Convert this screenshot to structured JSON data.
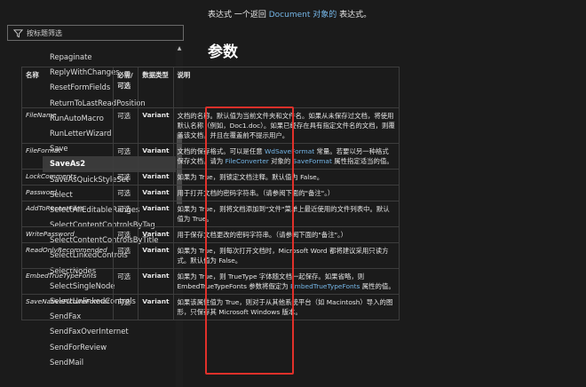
{
  "sidebar": {
    "filter_label": "按标题筛选",
    "items": [
      "Repaginate",
      "ReplyWithChanges",
      "ResetFormFields",
      "ReturnToLastReadPosition",
      "RunAutoMacro",
      "RunLetterWizard",
      "Save",
      "SaveAs2",
      "SaveAsQuickStyleSet",
      "Select",
      "SelectAllEditableRanges",
      "SelectContentControlsByTag",
      "SelectContentControlsByTitle",
      "SelectLinkedControls",
      "SelectNodes",
      "SelectSingleNode",
      "SelectUnlinkedControls",
      "SendFax",
      "SendFaxOverInternet",
      "SendForReview",
      "SendMail"
    ],
    "active_item": "SaveAs2"
  },
  "main": {
    "intro_pre": "表达式 一个返回 ",
    "intro_link": "Document 对象的",
    "intro_post": " 表达式。",
    "heading": "参数",
    "columns": [
      "名称",
      "必需/可选",
      "数据类型",
      "说明"
    ],
    "rows": [
      {
        "name": "FileName",
        "req": "可选",
        "type": "Variant",
        "desc": "文档的名称。默认值为当前文件夹和文件名。如果从未保存过文档，将使用默认名称（例如，Doc1.doc）。如果已经存在具有指定文件名的文档，则覆盖该文档，并且在覆盖前不提示用户。"
      },
      {
        "name": "FileFormat",
        "req": "可选",
        "type": "Variant",
        "desc_parts": [
          "文档的保存格式。可以是任意 ",
          "WdSaveFormat",
          " 常量。若要以另一种格式保存文档，请为 ",
          "FileConverter",
          " 对象的 ",
          "SaveFormat",
          " 属性指定适当的值。"
        ]
      },
      {
        "name": "LockComments",
        "req": "可选",
        "type": "Variant",
        "desc": "如果为 True，则锁定文档注释。默认值为 False。"
      },
      {
        "name": "Password",
        "req": "可选",
        "type": "Variant",
        "desc": "用于打开文档的密码字符串。（请参阅下面的\"备注\"。）"
      },
      {
        "name": "AddToRecentFiles",
        "req": "可选",
        "type": "Variant",
        "desc": "如果为 True，则将文档添加到\"文件\"菜单上最近使用的文件列表中。默认值为 True。"
      },
      {
        "name": "WritePassword",
        "req": "可选",
        "type": "Variant",
        "desc": "用于保存文档更改的密码字符串。（请参阅下面的\"备注\"。）"
      },
      {
        "name": "ReadOnlyRecommended",
        "req": "可选",
        "type": "Variant",
        "desc": "如果为 True，则每次打开文档时，Microsoft Word 都将建议采用只读方式。默认值为 False。"
      },
      {
        "name": "EmbedTrueTypeFonts",
        "req": "可选",
        "type": "Variant",
        "desc_parts": [
          "如果为 True，则 TrueType 字体随文档一起保存。如果省略，则 EmbedTrueTypeFonts 参数将假定为 ",
          "EmbedTrueTypeFonts",
          " 属性的值。"
        ]
      },
      {
        "name": "SaveNativePictureFormat",
        "req": "可选",
        "type": "Variant",
        "desc": "如果该属性值为 True，则对于从其他系统平台（如 Macintosh）导入的图形，只保存其 Microsoft Windows 版本。"
      }
    ]
  }
}
